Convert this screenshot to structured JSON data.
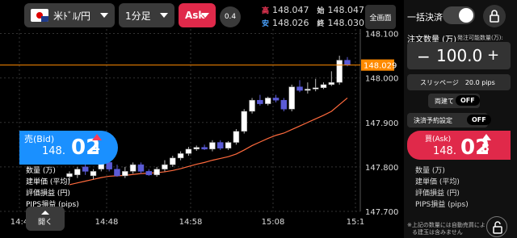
{
  "toolbar": {
    "pair": "米ﾄﾞﾙ/円",
    "timeframe": "1分足",
    "side": "Ask",
    "zoom": "0.4",
    "quotes": [
      {
        "a_label": "高",
        "a_value": "148.047",
        "b_label": "始",
        "b_value": "148.047"
      },
      {
        "a_label": "安",
        "a_value": "148.026",
        "b_label": "終",
        "b_value": "148.030"
      }
    ],
    "fullscreen": "全画面"
  },
  "chart_data": {
    "type": "candlestick",
    "y_ticks": [
      "148.100",
      "148.000",
      "147.900",
      "147.800",
      "147.700"
    ],
    "x_ticks": [
      "14:4",
      "14:48",
      "14:58",
      "15:08",
      "15:1"
    ],
    "current_price": "148.029",
    "ylim": [
      147.7,
      148.11
    ],
    "candles": [
      {
        "o": 147.778,
        "h": 147.79,
        "l": 147.77,
        "c": 147.785,
        "up": true
      },
      {
        "o": 147.782,
        "h": 147.8,
        "l": 147.775,
        "c": 147.795,
        "up": true
      },
      {
        "o": 147.8,
        "h": 147.812,
        "l": 147.782,
        "c": 147.79,
        "up": false
      },
      {
        "o": 147.78,
        "h": 147.795,
        "l": 147.772,
        "c": 147.79,
        "up": true
      },
      {
        "o": 147.795,
        "h": 147.815,
        "l": 147.79,
        "c": 147.81,
        "up": true
      },
      {
        "o": 147.81,
        "h": 147.815,
        "l": 147.79,
        "c": 147.795,
        "up": false
      },
      {
        "o": 147.795,
        "h": 147.805,
        "l": 147.778,
        "c": 147.78,
        "up": false
      },
      {
        "o": 147.78,
        "h": 147.8,
        "l": 147.775,
        "c": 147.79,
        "up": true
      },
      {
        "o": 147.79,
        "h": 147.81,
        "l": 147.785,
        "c": 147.805,
        "up": true
      },
      {
        "o": 147.805,
        "h": 147.81,
        "l": 147.785,
        "c": 147.79,
        "up": false
      },
      {
        "o": 147.79,
        "h": 147.795,
        "l": 147.78,
        "c": 147.782,
        "up": false
      },
      {
        "o": 147.782,
        "h": 147.8,
        "l": 147.778,
        "c": 147.795,
        "up": true
      },
      {
        "o": 147.795,
        "h": 147.815,
        "l": 147.79,
        "c": 147.805,
        "up": true
      },
      {
        "o": 147.805,
        "h": 147.825,
        "l": 147.8,
        "c": 147.82,
        "up": true
      },
      {
        "o": 147.82,
        "h": 147.835,
        "l": 147.815,
        "c": 147.83,
        "up": true
      },
      {
        "o": 147.83,
        "h": 147.845,
        "l": 147.825,
        "c": 147.84,
        "up": true
      },
      {
        "o": 147.84,
        "h": 147.848,
        "l": 147.836,
        "c": 147.844,
        "up": true
      },
      {
        "o": 147.844,
        "h": 147.85,
        "l": 147.838,
        "c": 147.84,
        "up": false
      },
      {
        "o": 147.84,
        "h": 147.86,
        "l": 147.835,
        "c": 147.855,
        "up": true
      },
      {
        "o": 147.855,
        "h": 147.86,
        "l": 147.838,
        "c": 147.842,
        "up": false
      },
      {
        "o": 147.842,
        "h": 147.858,
        "l": 147.838,
        "c": 147.855,
        "up": true
      },
      {
        "o": 147.855,
        "h": 147.885,
        "l": 147.85,
        "c": 147.88,
        "up": true
      },
      {
        "o": 147.88,
        "h": 147.93,
        "l": 147.875,
        "c": 147.925,
        "up": true
      },
      {
        "o": 147.925,
        "h": 147.955,
        "l": 147.92,
        "c": 147.95,
        "up": true
      },
      {
        "o": 147.95,
        "h": 147.962,
        "l": 147.938,
        "c": 147.942,
        "up": false
      },
      {
        "o": 147.942,
        "h": 147.958,
        "l": 147.938,
        "c": 147.955,
        "up": true
      },
      {
        "o": 147.955,
        "h": 147.962,
        "l": 147.945,
        "c": 147.95,
        "up": false
      },
      {
        "o": 147.95,
        "h": 147.955,
        "l": 147.925,
        "c": 147.93,
        "up": false
      },
      {
        "o": 147.93,
        "h": 147.985,
        "l": 147.925,
        "c": 147.98,
        "up": true
      },
      {
        "o": 147.98,
        "h": 147.995,
        "l": 147.968,
        "c": 147.972,
        "up": false
      },
      {
        "o": 147.972,
        "h": 147.99,
        "l": 147.965,
        "c": 147.975,
        "up": true
      },
      {
        "o": 147.975,
        "h": 147.998,
        "l": 147.97,
        "c": 147.978,
        "up": true
      },
      {
        "o": 147.978,
        "h": 147.99,
        "l": 147.975,
        "c": 147.985,
        "up": true
      },
      {
        "o": 147.985,
        "h": 148.015,
        "l": 147.982,
        "c": 147.99,
        "up": true
      },
      {
        "o": 147.99,
        "h": 148.05,
        "l": 147.985,
        "c": 148.04,
        "up": true
      },
      {
        "o": 148.04,
        "h": 148.047,
        "l": 148.026,
        "c": 148.03,
        "up": false
      }
    ],
    "ma": [
      147.76,
      147.764,
      147.768,
      147.772,
      147.776,
      147.779,
      147.78,
      147.781,
      147.783,
      147.785,
      147.786,
      147.787,
      147.789,
      147.792,
      147.796,
      147.801,
      147.806,
      147.81,
      147.815,
      147.819,
      147.823,
      147.829,
      147.838,
      147.848,
      147.856,
      147.864,
      147.871,
      147.876,
      147.884,
      147.892,
      147.9,
      147.908,
      147.916,
      147.925,
      147.94,
      147.955
    ],
    "colors": {
      "up": "#ffffff",
      "down": "#5b5bd6",
      "ma": "#ff6a3d",
      "price_line": "#ff8a00"
    }
  },
  "left_panel": {
    "bid_label": "売(Bid)",
    "bid_small": "148.",
    "bid_big": "02",
    "bid_last": "4",
    "rows": [
      "数量 (万)",
      "建単価 (平均)",
      "評価損益 (円)",
      "PIPS損益 (pips)"
    ],
    "open": "開く"
  },
  "right_panel": {
    "bulk": "一括決済",
    "qty_label": "注文数量 (万)",
    "qty_sub": "発注可能数量(万):",
    "qty_value": "100.0",
    "minus": "−",
    "plus": "+",
    "slippage": "スリッページ",
    "slippage_value": "20.0 pips",
    "ryodate": "両建て",
    "ryodate_off": "OFF",
    "kessai": "決済予約設定",
    "kessai_off": "OFF",
    "ask_label": "買(Ask)",
    "ask_small": "148.",
    "ask_big": "02",
    "ask_last": "8",
    "rows": [
      "数量 (万)",
      "建単価 (平均)",
      "評価損益 (円)",
      "PIPS損益 (pips)"
    ],
    "note1": "※上記の数量には自動売買によ",
    "note2": "る建玉は含みません"
  }
}
